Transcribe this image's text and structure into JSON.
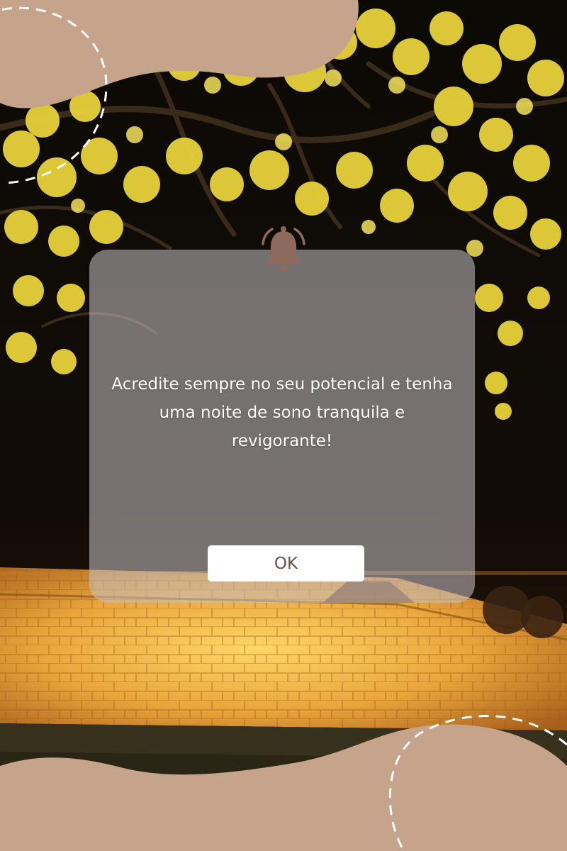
{
  "dialog": {
    "message": "Acredite sempre no seu potencial e tenha uma noite de sono tranquila e revigorante!",
    "ok_label": "OK"
  },
  "icons": {
    "notification": "bell-icon"
  },
  "colors": {
    "blob": "#c6a48c",
    "bell": "#8e6a5c",
    "button_text": "#6b5047",
    "divider": "#8d6c62",
    "dialog_overlay": "rgba(198,192,196,0.56)"
  }
}
